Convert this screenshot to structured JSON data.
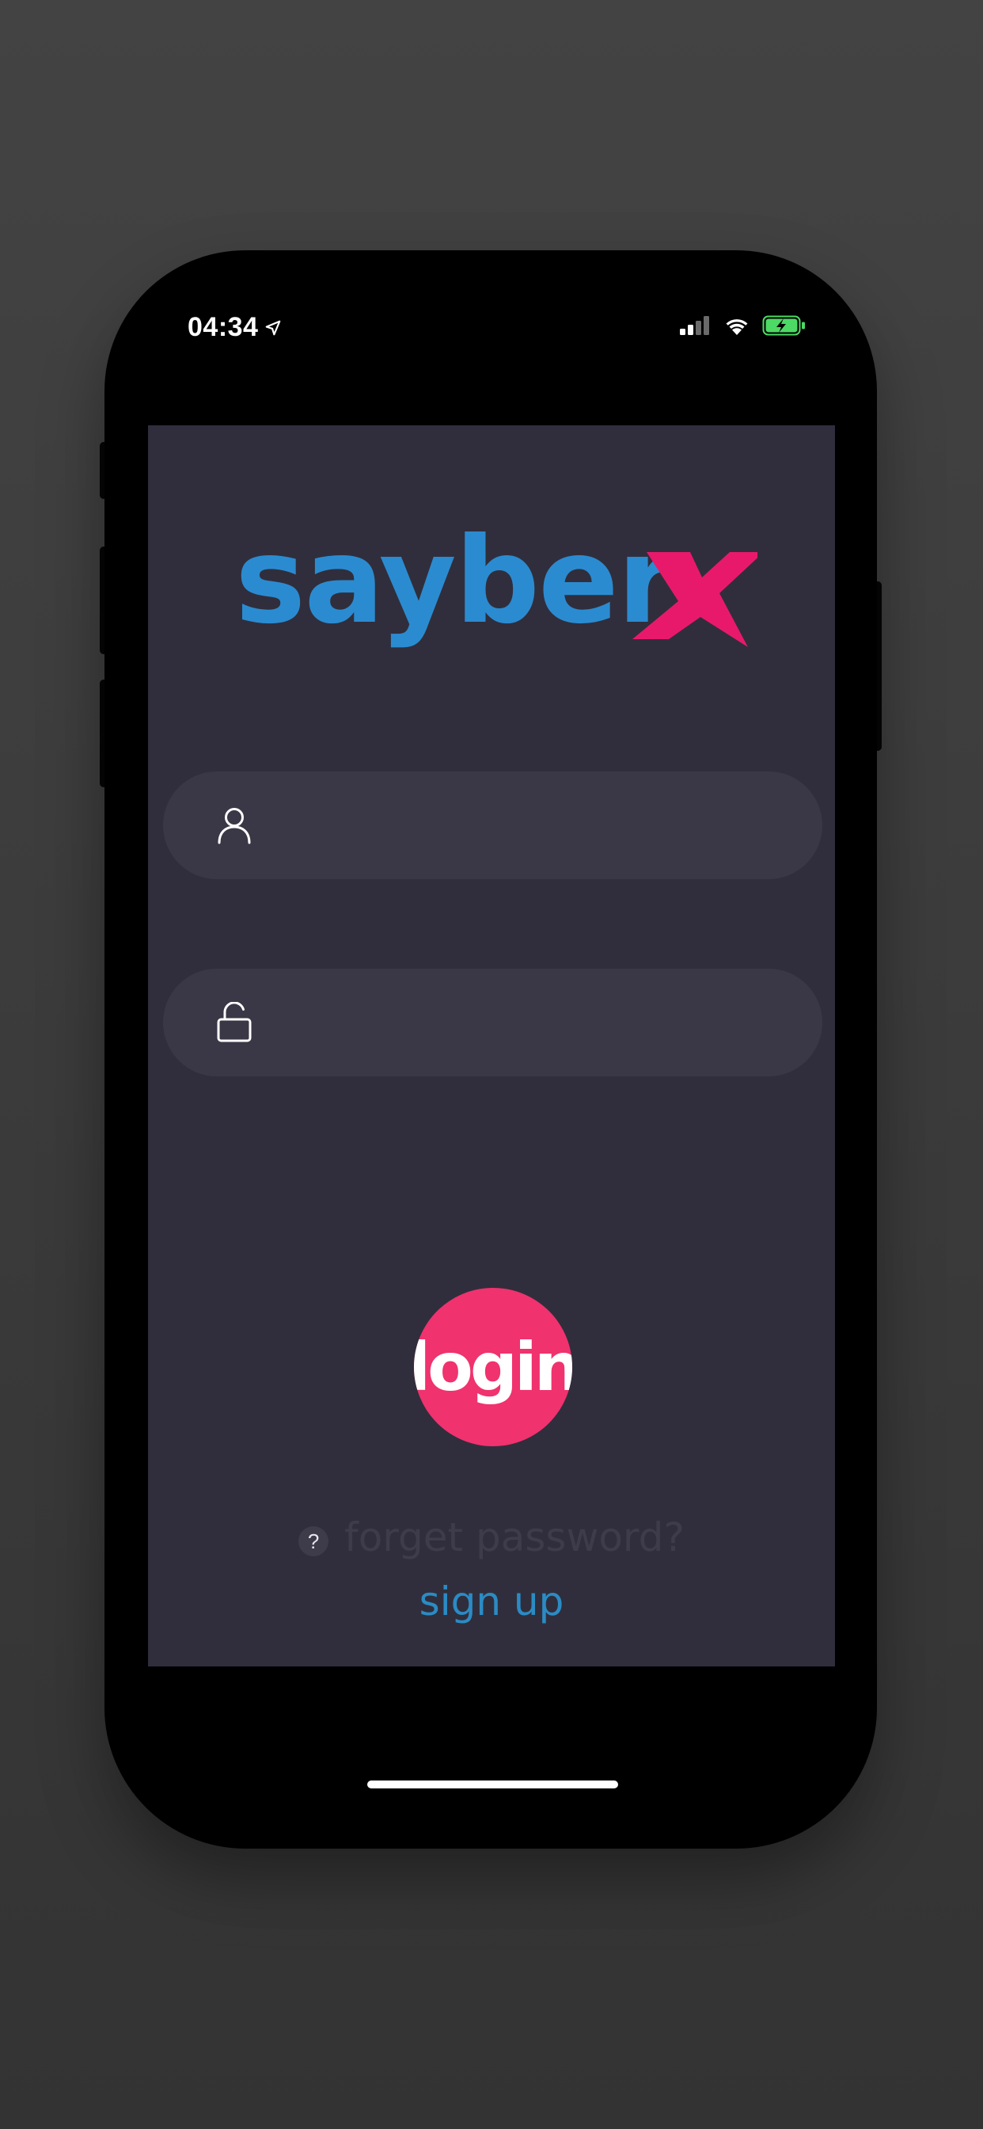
{
  "status_bar": {
    "time": "04:34",
    "location_icon": "location-arrow-icon",
    "signal_icon": "cellular-signal-icon",
    "wifi_icon": "wifi-icon",
    "battery_icon": "battery-charging-icon"
  },
  "logo": {
    "text_part1": "sayber",
    "text_part2": "x",
    "color_part1": "#2b8bd0",
    "color_part2": "#e8196b"
  },
  "form": {
    "username": {
      "icon": "user-icon",
      "value": "",
      "placeholder": ""
    },
    "password": {
      "icon": "unlock-icon",
      "value": "",
      "placeholder": ""
    }
  },
  "login_button": {
    "label": "login",
    "color": "#f0326e"
  },
  "forget_password": {
    "icon": "question-icon",
    "icon_glyph": "?",
    "label": "forget password?"
  },
  "sign_up": {
    "label": "sign up",
    "color": "#2b8bc4"
  },
  "colors": {
    "app_background": "#302e3c",
    "field_background": "#3a3846"
  }
}
